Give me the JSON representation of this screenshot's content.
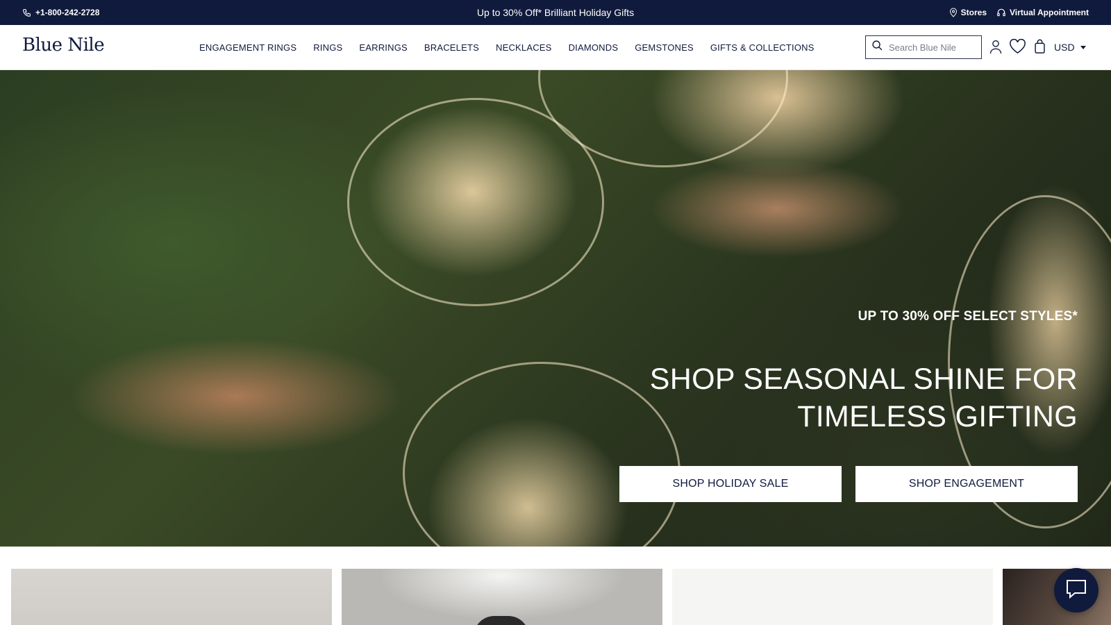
{
  "topbar": {
    "phone": "+1-800-242-2728",
    "promo": "Up to 30% Off* Brilliant Holiday Gifts",
    "stores_label": "Stores",
    "virtual_label": "Virtual Appointment"
  },
  "header": {
    "logo": "Blue Nile",
    "nav": [
      {
        "label": "ENGAGEMENT RINGS"
      },
      {
        "label": "RINGS"
      },
      {
        "label": "EARRINGS"
      },
      {
        "label": "BRACELETS"
      },
      {
        "label": "NECKLACES"
      },
      {
        "label": "DIAMONDS"
      },
      {
        "label": "GEMSTONES"
      },
      {
        "label": "GIFTS & COLLECTIONS"
      }
    ],
    "search": {
      "placeholder": "Search Blue Nile",
      "value": ""
    },
    "currency": "USD"
  },
  "hero": {
    "eyebrow": "UP TO 30% OFF SELECT STYLES*",
    "headline": "SHOP SEASONAL SHINE FOR TIMELESS GIFTING",
    "buttons": {
      "primary": "SHOP HOLIDAY SALE",
      "secondary": "SHOP ENGAGEMENT"
    }
  },
  "icons": {
    "phone": "phone-icon",
    "stores": "map-pin-icon",
    "virtual": "headset-icon",
    "search": "search-icon",
    "account": "user-icon",
    "wishlist": "heart-icon",
    "bag": "shopping-bag-icon",
    "chat": "chat-icon"
  },
  "colors": {
    "brand_navy": "#101a3c",
    "button_bg": "#ffffff"
  }
}
